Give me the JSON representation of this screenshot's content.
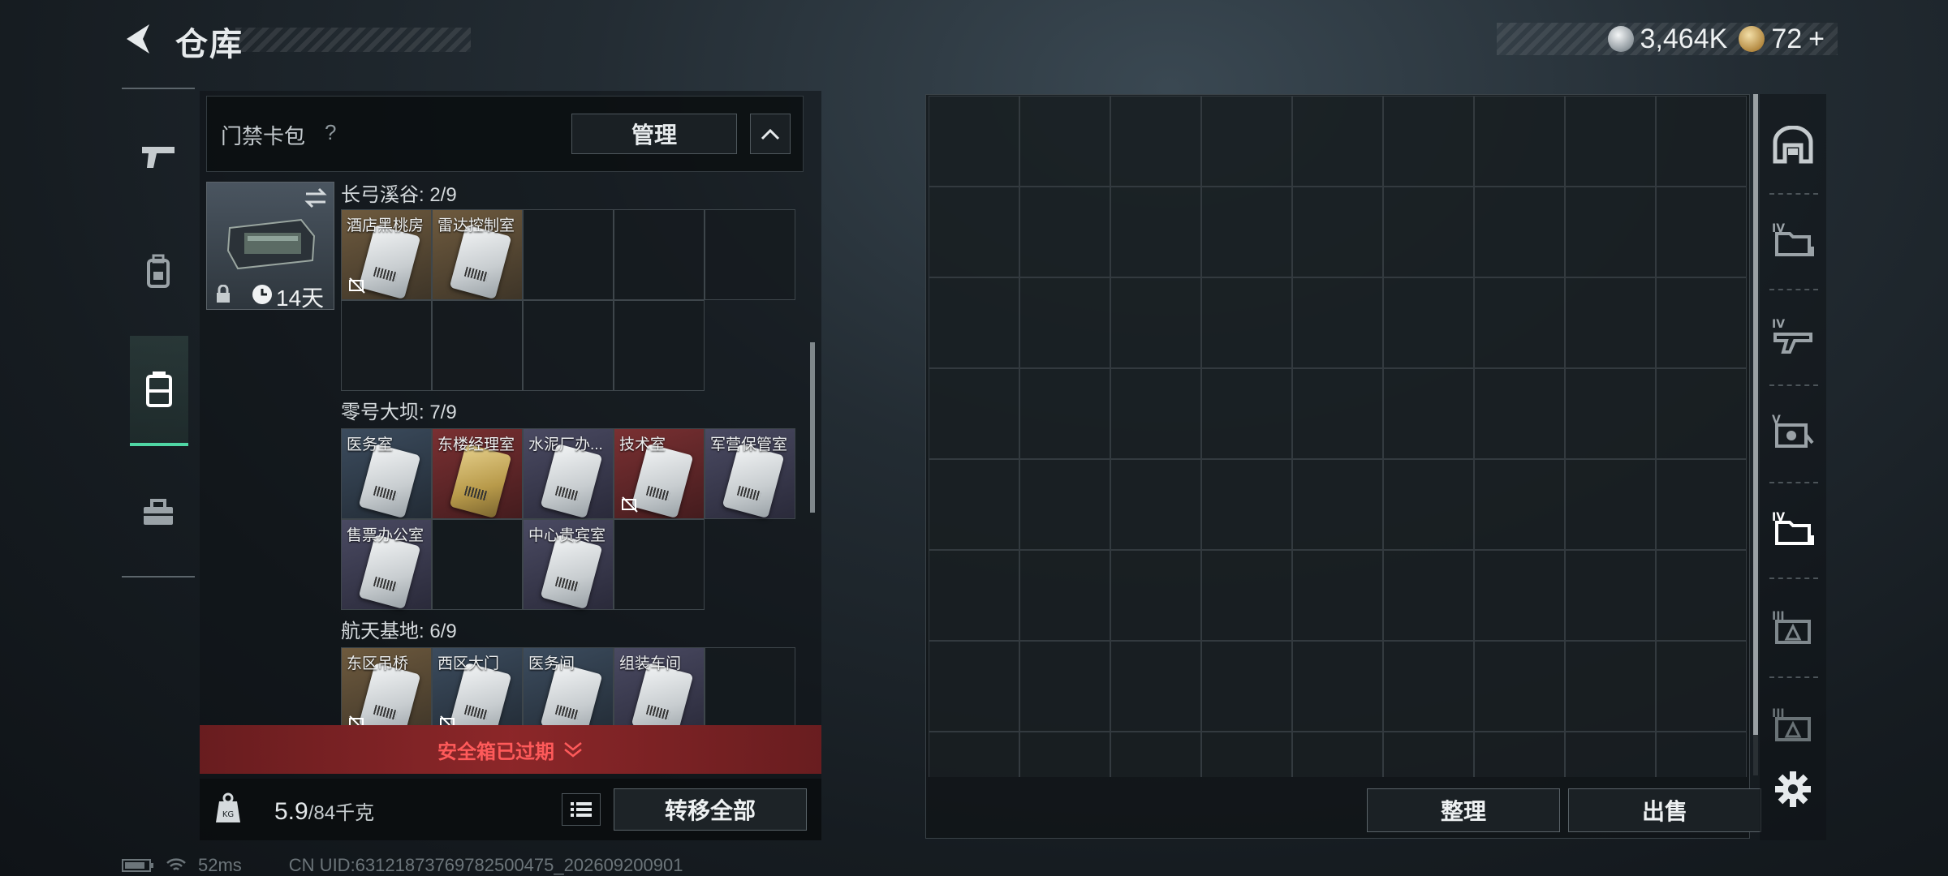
{
  "header": {
    "title": "仓库",
    "currency_silver": "3,464K",
    "currency_gold": "72",
    "gold_add": "+"
  },
  "left_nav": {
    "items": [
      {
        "name": "weapons",
        "icon": "gun-icon"
      },
      {
        "name": "gear",
        "icon": "backpack-icon"
      },
      {
        "name": "case",
        "icon": "case-icon",
        "active": true
      },
      {
        "name": "toolbox",
        "icon": "toolbox-icon"
      }
    ]
  },
  "card_pack": {
    "title": "门禁卡包",
    "help": "?",
    "manage_label": "管理",
    "timer": "14天"
  },
  "sections": [
    {
      "title": "长弓溪谷: 2/9",
      "slots": [
        {
          "label": "酒店黑桃房",
          "color": "orange",
          "no_trade": true
        },
        {
          "label": "雷达控制室",
          "color": "orange",
          "no_trade": false
        }
      ]
    },
    {
      "title": "零号大坝: 7/9",
      "slots": [
        {
          "label": "医务室",
          "color": "blue"
        },
        {
          "label": "东楼经理室",
          "color": "red",
          "gold": true
        },
        {
          "label": "水泥厂办...",
          "color": "purple"
        },
        {
          "label": "技术室",
          "color": "red",
          "no_trade": true
        },
        {
          "label": "军营保管室",
          "color": "purple"
        },
        {
          "label": "售票办公室",
          "color": "purple"
        },
        {
          "label": "中心贵宾室",
          "color": "purple"
        }
      ]
    },
    {
      "title": "航天基地: 6/9",
      "slots": [
        {
          "label": "东区吊桥",
          "color": "orange",
          "no_trade": true
        },
        {
          "label": "西区大门",
          "color": "blue",
          "no_trade": true
        },
        {
          "label": "医务间",
          "color": "blue"
        },
        {
          "label": "组装车间",
          "color": "purple"
        }
      ]
    }
  ],
  "banner": {
    "text": "安全箱已过期",
    "color": "#ff5a5a"
  },
  "footer_left": {
    "weight_current": "5.9",
    "weight_max": "/84千克",
    "weight_icon_text": "KG",
    "transfer_all_label": "转移全部"
  },
  "stash": {
    "sort_label": "整理",
    "sell_label": "出售"
  },
  "right_tabs": [
    {
      "name": "home",
      "icon": "arch-icon"
    },
    {
      "name": "tier-iv-a",
      "icon": "folder-iv-icon",
      "tier": "IV"
    },
    {
      "name": "tier-iv-b",
      "icon": "gun-iv-icon",
      "tier": "IV"
    },
    {
      "name": "tier-v",
      "icon": "vest-v-icon",
      "tier": "V"
    },
    {
      "name": "tier-iv-c",
      "icon": "folder-iv-active-icon",
      "tier": "IV",
      "active": true
    },
    {
      "name": "tier-iii-a",
      "icon": "triangle-iii-icon",
      "tier": "III"
    },
    {
      "name": "tier-iii-b",
      "icon": "triangle-iii-icon",
      "tier": "III"
    }
  ],
  "status": {
    "ping": "52ms",
    "uid": "CN UID:6312187376978250047​5_202609200901"
  },
  "colors": {
    "accent_green": "#4fd6a4",
    "banner_red": "#ff5a5a"
  }
}
